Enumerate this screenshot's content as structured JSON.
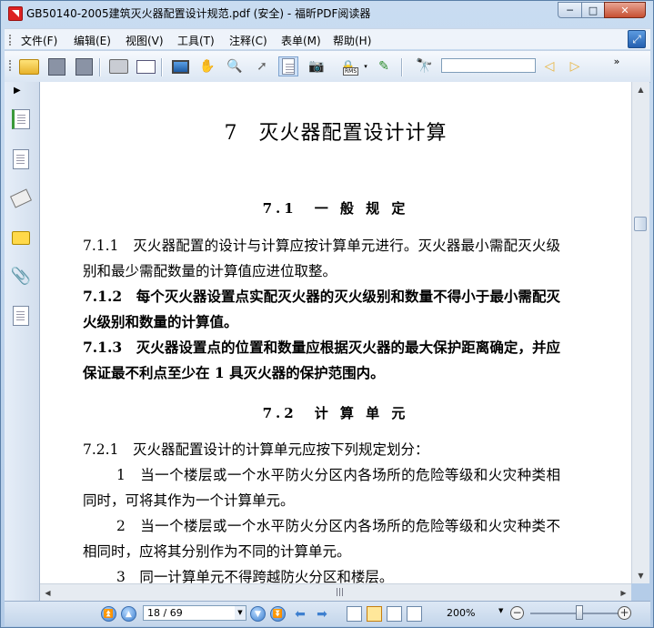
{
  "window": {
    "title": "GB50140-2005建筑灭火器配置设计规范.pdf (安全) - 福昕PDF阅读器",
    "min_symbol": "─",
    "max_symbol": "□",
    "close_symbol": "✕"
  },
  "menu": [
    {
      "label": "文件(F)"
    },
    {
      "label": "编辑(E)"
    },
    {
      "label": "视图(V)"
    },
    {
      "label": "工具(T)"
    },
    {
      "label": "注释(C)"
    },
    {
      "label": "表单(M)"
    },
    {
      "label": "帮助(H)"
    }
  ],
  "toolbar": {
    "rms_label": "RMS",
    "overflow": "»",
    "search_placeholder": ""
  },
  "left_panel": {
    "toggle": "▶"
  },
  "document": {
    "chapter_title": "7　灭火器配置设计计算",
    "section1": "7.1　一 般 规 定",
    "p711": "7.1.1　灭火器配置的设计与计算应按计算单元进行。灭火器最小需配灭火级别和最少需配数量的计算值应进位取整。",
    "p712": "7.1.2　每个灭火器设置点实配灭火器的灭火级别和数量不得小于最小需配灭火级别和数量的计算值。",
    "p713": "7.1.3　灭火器设置点的位置和数量应根据灭火器的最大保护距离确定，并应保证最不利点至少在 1 具灭火器的保护范围内。",
    "section2": "7.2　计 算 单 元",
    "p721": "7.2.1　灭火器配置设计的计算单元应按下列规定划分：",
    "item1": "1　当一个楼层或一个水平防火分区内各场所的危险等级和火灾种类相同时，可将其作为一个计算单元。",
    "item2": "2　当一个楼层或一个水平防火分区内各场所的危险等级和火灾种类不相同时，应将其分别作为不同的计算单元。",
    "item3": "3　同一计算单元不得跨越防火分区和楼层。"
  },
  "statusbar": {
    "page_indicator": "18 / 69",
    "zoom": "200%",
    "zoom_out": "−",
    "zoom_in": "+"
  },
  "zoom_slider_position": 0.5
}
